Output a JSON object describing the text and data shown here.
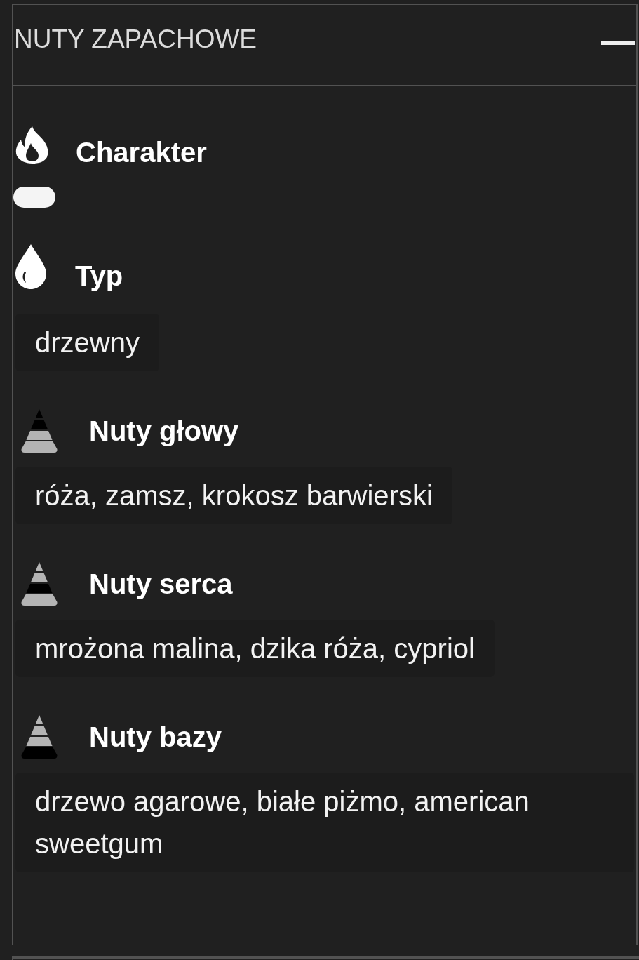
{
  "panel": {
    "title": "NUTY ZAPACHOWE",
    "expanded": true
  },
  "sections": [
    {
      "kind": "character",
      "heading": "Charakter"
    },
    {
      "kind": "type",
      "heading": "Typ",
      "value": "drzewny"
    },
    {
      "kind": "top",
      "heading": "Nuty głowy",
      "value": "róża, zamsz, krokosz barwierski"
    },
    {
      "kind": "heart",
      "heading": "Nuty serca",
      "value": "mrożona malina, dzika róża, cypriol"
    },
    {
      "kind": "base",
      "heading": "Nuty bazy",
      "value": "drzewo agarowe, białe piżmo, american sweetgum"
    }
  ]
}
